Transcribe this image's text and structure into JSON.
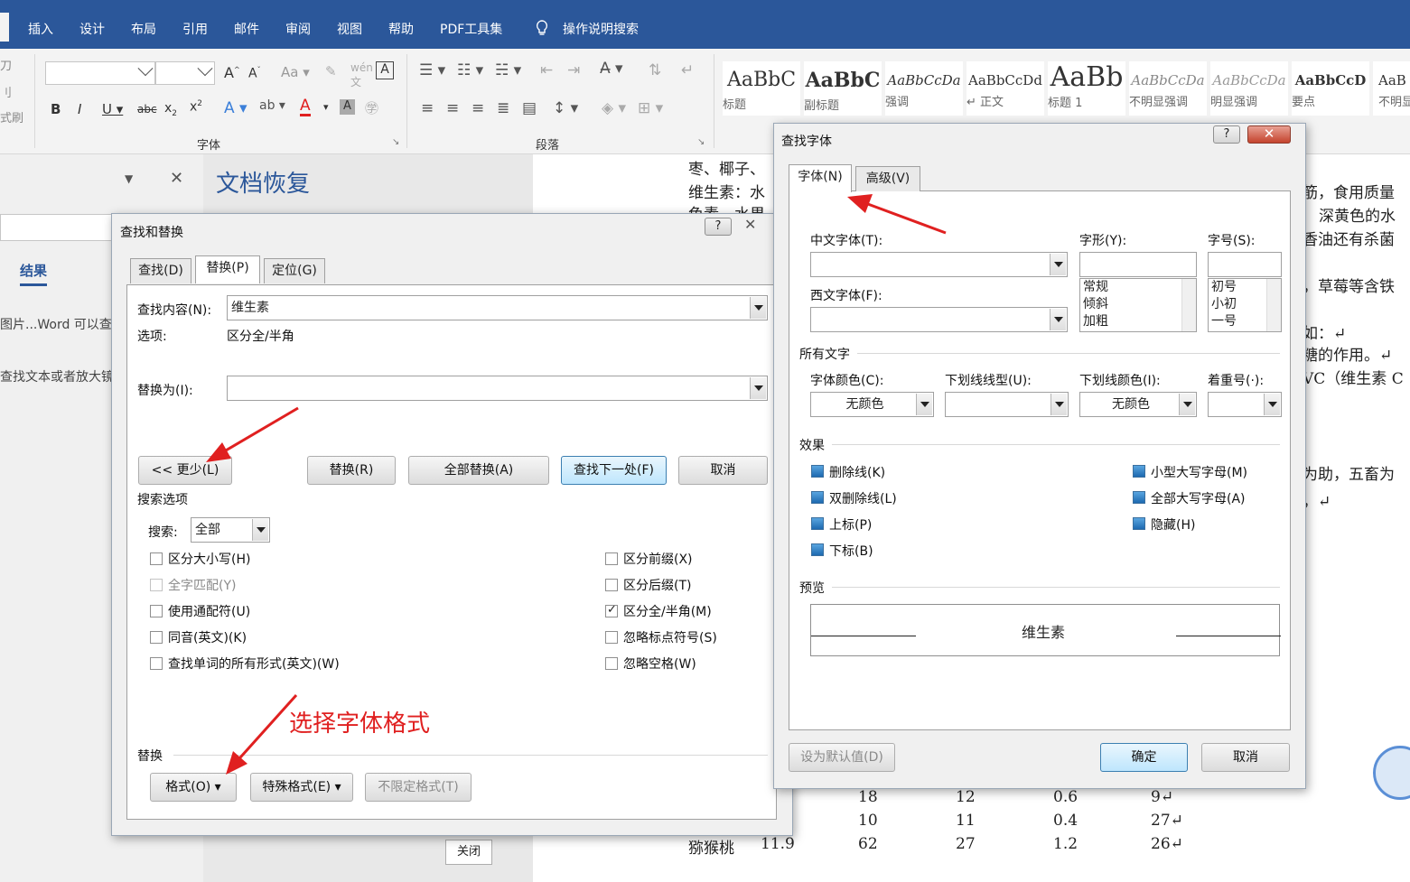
{
  "ribbon_tabs": [
    "插入",
    "设计",
    "布局",
    "引用",
    "邮件",
    "审阅",
    "视图",
    "帮助",
    "PDF工具集"
  ],
  "ribbon_search": "操作说明搜索",
  "ribbon_left_fragments": [
    "刀",
    "刂",
    "式刷"
  ],
  "font_group_label": "字体",
  "paragraph_group_label": "段落",
  "styles": [
    {
      "sample": "AaBbC",
      "label": "标题"
    },
    {
      "sample": "AaBbC",
      "label": "副标题"
    },
    {
      "sample": "AaBbCcDa",
      "label": "强调"
    },
    {
      "sample": "AaBbCcDd",
      "label": "↵ 正文"
    },
    {
      "sample": "AaBb",
      "label": "标题 1"
    },
    {
      "sample": "AaBbCcDa",
      "label": "不明显强调"
    },
    {
      "sample": "AaBbCcDa",
      "label": "明显强调"
    },
    {
      "sample": "AaBbCcD",
      "label": "要点"
    },
    {
      "sample": "AaB",
      "label": "不明显"
    }
  ],
  "left_pane": {
    "results_tab": "结果",
    "line1": "图片...Word 可以查",
    "line2": "查找文本或者放大镜"
  },
  "recovery": {
    "title": "文档恢复",
    "close_label": "关闭"
  },
  "doc_lines": [
    "枣、椰子、",
    "维生素：水",
    "色素，水果",
    "筋，食用质量",
    "深黄色的水",
    "香油还有杀菌",
    "，草莓等含铁",
    "如：↵",
    "糖的作用。↵",
    "VC（维生素 C",
    "为助，五畜为",
    "，↵"
  ],
  "doc_table": [
    [
      "",
      "",
      "18",
      "12",
      "0.6",
      "9↵"
    ],
    [
      "",
      "",
      "10",
      "11",
      "0.4",
      "27↵"
    ],
    [
      "猕猴桃",
      "11.9",
      "62",
      "27",
      "1.2",
      "26↵"
    ]
  ],
  "find_replace": {
    "title": "查找和替换",
    "tabs": [
      "查找(D)",
      "替换(P)",
      "定位(G)"
    ],
    "find_label": "查找内容(N):",
    "find_value": "维生素",
    "options_label": "选项:",
    "options_value": "区分全/半角",
    "replace_label": "替换为(I):",
    "replace_value": "",
    "btn_less": "<< 更少(L)",
    "btn_replace": "替换(R)",
    "btn_replace_all": "全部替换(A)",
    "btn_find_next": "查找下一处(F)",
    "btn_cancel": "取消",
    "search_options": "搜索选项",
    "search_label": "搜索:",
    "search_value": "全部",
    "checks_left": [
      {
        "label": "区分大小写(H)",
        "checked": false,
        "disabled": false
      },
      {
        "label": "全字匹配(Y)",
        "checked": false,
        "disabled": true
      },
      {
        "label": "使用通配符(U)",
        "checked": false,
        "disabled": false
      },
      {
        "label": "同音(英文)(K)",
        "checked": false,
        "disabled": false
      },
      {
        "label": "查找单词的所有形式(英文)(W)",
        "checked": false,
        "disabled": false
      }
    ],
    "checks_right": [
      {
        "label": "区分前缀(X)",
        "checked": false
      },
      {
        "label": "区分后缀(T)",
        "checked": false
      },
      {
        "label": "区分全/半角(M)",
        "checked": true
      },
      {
        "label": "忽略标点符号(S)",
        "checked": false
      },
      {
        "label": "忽略空格(W)",
        "checked": false
      }
    ],
    "annotation": "选择字体格式",
    "replace_section": "替换",
    "btn_format": "格式(O) ▾",
    "btn_special": "特殊格式(E) ▾",
    "btn_noformat": "不限定格式(T)",
    "close_x": "✕",
    "help": "?"
  },
  "find_font": {
    "title": "查找字体",
    "tabs": [
      "字体(N)",
      "高级(V)"
    ],
    "cn_font_label": "中文字体(T):",
    "west_font_label": "西文字体(F):",
    "style_label": "字形(Y):",
    "size_label": "字号(S):",
    "styles": [
      "常规",
      "倾斜",
      "加粗"
    ],
    "sizes": [
      "初号",
      "小初",
      "一号"
    ],
    "all_text": "所有文字",
    "font_color_label": "字体颜色(C):",
    "font_color_value": "无颜色",
    "underline_type_label": "下划线线型(U):",
    "underline_color_label": "下划线颜色(I):",
    "underline_color_value": "无颜色",
    "emphasis_label": "着重号(·):",
    "effects": "效果",
    "effects_left": [
      "删除线(K)",
      "双删除线(L)",
      "上标(P)",
      "下标(B)"
    ],
    "effects_right": [
      "小型大写字母(M)",
      "全部大写字母(A)",
      "隐藏(H)"
    ],
    "preview": "预览",
    "preview_text": "维生素",
    "btn_default": "设为默认值(D)",
    "btn_ok": "确定",
    "btn_cancel": "取消",
    "help": "?",
    "close_x": "✕"
  },
  "colors": {
    "ribbon_blue": "#2b579a",
    "annotation_red": "#e02020"
  }
}
